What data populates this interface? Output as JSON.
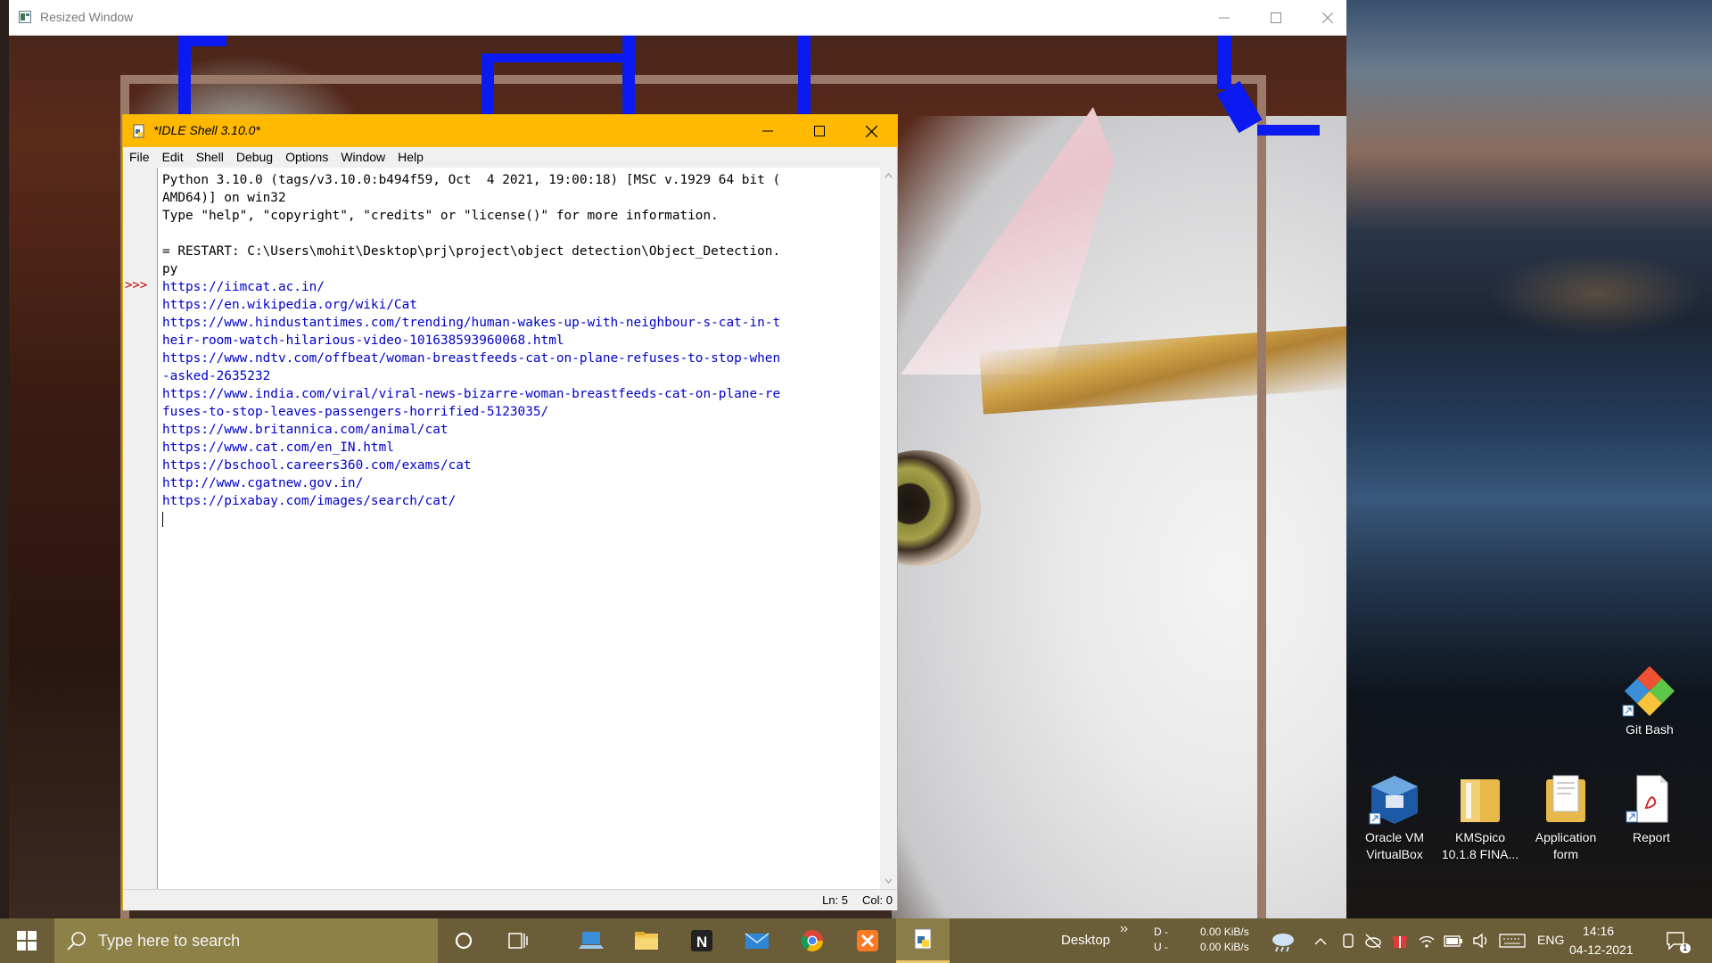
{
  "resized_window": {
    "title": "Resized Window"
  },
  "idle": {
    "title": "*IDLE Shell 3.10.0*",
    "menu": [
      "File",
      "Edit",
      "Shell",
      "Debug",
      "Options",
      "Window",
      "Help"
    ],
    "prompt": ">>>",
    "lines": [
      {
        "text": "Python 3.10.0 (tags/v3.10.0:b494f59, Oct  4 2021, 19:00:18) [MSC v.1929 64 bit (",
        "url": false
      },
      {
        "text": "AMD64)] on win32",
        "url": false
      },
      {
        "text": "Type \"help\", \"copyright\", \"credits\" or \"license()\" for more information.",
        "url": false
      },
      {
        "text": "",
        "url": false
      },
      {
        "text": "= RESTART: C:\\Users\\mohit\\Desktop\\prj\\project\\object detection\\Object_Detection.",
        "url": false
      },
      {
        "text": "py",
        "url": false
      },
      {
        "text": "https://iimcat.ac.in/",
        "url": true
      },
      {
        "text": "https://en.wikipedia.org/wiki/Cat",
        "url": true
      },
      {
        "text": "https://www.hindustantimes.com/trending/human-wakes-up-with-neighbour-s-cat-in-t",
        "url": true
      },
      {
        "text": "heir-room-watch-hilarious-video-101638593960068.html",
        "url": true
      },
      {
        "text": "https://www.ndtv.com/offbeat/woman-breastfeeds-cat-on-plane-refuses-to-stop-when",
        "url": true
      },
      {
        "text": "-asked-2635232",
        "url": true
      },
      {
        "text": "https://www.india.com/viral/viral-news-bizarre-woman-breastfeeds-cat-on-plane-re",
        "url": true
      },
      {
        "text": "fuses-to-stop-leaves-passengers-horrified-5123035/",
        "url": true
      },
      {
        "text": "https://www.britannica.com/animal/cat",
        "url": true
      },
      {
        "text": "https://www.cat.com/en_IN.html",
        "url": true
      },
      {
        "text": "https://bschool.careers360.com/exams/cat",
        "url": true
      },
      {
        "text": "http://www.cgatnew.gov.in/",
        "url": true
      },
      {
        "text": "https://pixabay.com/images/search/cat/",
        "url": true
      }
    ],
    "status": {
      "ln": "Ln: 5",
      "col": "Col: 0"
    }
  },
  "desktop_icons": [
    {
      "name": "git-bash",
      "label": "Git Bash"
    },
    {
      "name": "oracle-vm-virtualbox",
      "label": "Oracle VM VirtualBox"
    },
    {
      "name": "kmspico",
      "label": "KMSpico 10.1.8 FINA..."
    },
    {
      "name": "application-form",
      "label": "Application form"
    },
    {
      "name": "report",
      "label": "Report"
    }
  ],
  "taskbar": {
    "search_placeholder": "Type here to search",
    "desktop_label": "Desktop",
    "net_d_label": "D -",
    "net_u_label": "U -",
    "net_down": "0.00 KiB/s",
    "net_up": "0.00 KiB/s",
    "language": "ENG",
    "time": "14:16",
    "date": "04-12-2021",
    "notification_count": "1"
  },
  "colors": {
    "idle_titlebar": "#ffb900",
    "taskbar": "#6b5d37",
    "url": "#0000cc",
    "prompt": "#c00000"
  }
}
